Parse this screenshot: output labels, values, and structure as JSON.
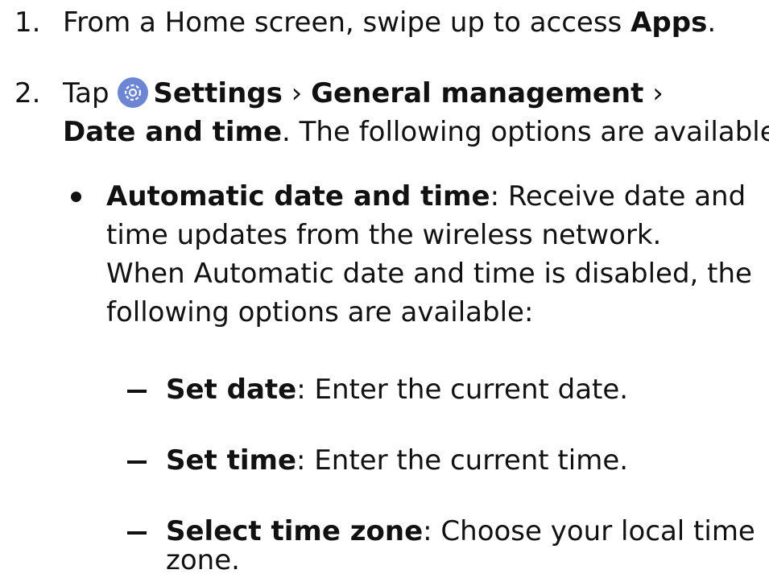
{
  "steps": [
    {
      "number": "1.",
      "pre": "From a Home screen, swipe up to access ",
      "bold": "Apps",
      "post": "."
    },
    {
      "number": "2.",
      "tap": "Tap ",
      "settings": "Settings",
      "sep1": " › ",
      "general": "General management",
      "sep2": " ›",
      "date_time": "Date and time",
      "post": ". The following options are available:"
    }
  ],
  "option": {
    "title": "Automatic date and time",
    "line1": ": Receive date and",
    "line2": "time updates from the wireless network.",
    "line3": "When Automatic date and time is disabled, the",
    "line4": "following options are available:"
  },
  "sub_options": [
    {
      "title": "Set date",
      "desc": ": Enter the current date."
    },
    {
      "title": "Set time",
      "desc": ": Enter the current time."
    },
    {
      "title": "Select time zone",
      "desc_line1": ": Choose your local time",
      "desc_line2": "zone."
    }
  ],
  "icons": {
    "settings": "gear-icon",
    "settings_color": "#6c86d4"
  }
}
